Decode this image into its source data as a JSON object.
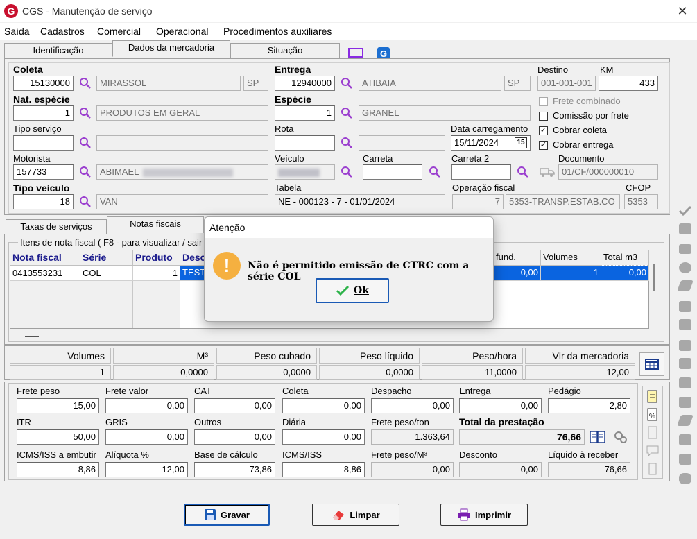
{
  "window": {
    "title": "CGS - Manutenção de serviço",
    "logo_letter": "G"
  },
  "menu": [
    "Saída",
    "Cadastros",
    "Comercial",
    "Operacional",
    "Procedimentos auxiliares"
  ],
  "tabs": [
    "Identificação",
    "Dados da mercadoria",
    "Situação"
  ],
  "form": {
    "coleta": {
      "label": "Coleta",
      "code": "15130000",
      "city": "MIRASSOL",
      "uf": "SP"
    },
    "entrega": {
      "label": "Entrega",
      "code": "12940000",
      "city": "ATIBAIA",
      "uf": "SP"
    },
    "destino": {
      "label": "Destino",
      "value": "001-001-001"
    },
    "km": {
      "label": "KM",
      "value": "433"
    },
    "nat_especie": {
      "label": "Nat. espécie",
      "code": "1",
      "desc": "PRODUTOS EM GERAL"
    },
    "especie": {
      "label": "Espécie",
      "code": "1",
      "desc": "GRANEL"
    },
    "tipo_servico": {
      "label": "Tipo serviço"
    },
    "rota": {
      "label": "Rota"
    },
    "data_carregamento": {
      "label": "Data carregamento",
      "value": "15/11/2024",
      "cal_icon": "15"
    },
    "motorista": {
      "label": "Motorista",
      "code": "157733",
      "name": "ABIMAEL"
    },
    "veiculo": {
      "label": "Veículo"
    },
    "carreta": {
      "label": "Carreta"
    },
    "carreta2": {
      "label": "Carreta 2"
    },
    "documento": {
      "label": "Documento",
      "value": "01/CF/000000010"
    },
    "tipo_veiculo": {
      "label": "Tipo veículo",
      "code": "18",
      "desc": "VAN"
    },
    "tabela": {
      "label": "Tabela",
      "value": "NE - 000123 - 7 - 01/01/2024"
    },
    "operacao_fiscal": {
      "label": "Operação fiscal",
      "code": "7",
      "desc": "5353-TRANSP.ESTAB.CO"
    },
    "cfop": {
      "label": "CFOP",
      "value": "5353"
    },
    "checks": {
      "frete_combinado": {
        "label": "Frete combinado",
        "checked": false
      },
      "comissao": {
        "label": "Comissão por frete",
        "checked": false
      },
      "cobrar_coleta": {
        "label": "Cobrar coleta",
        "checked": true
      },
      "cobrar_entrega": {
        "label": "Cobrar entrega",
        "checked": true
      }
    },
    "check_mark": "✓"
  },
  "subtabs": [
    "Taxas de serviços",
    "Notas fiscais"
  ],
  "itens": {
    "caption": "Itens de nota fiscal ( F8 - para visualizar / sair",
    "headers": [
      "Nota fiscal",
      "Série",
      "Produto",
      "Desc"
    ],
    "headers_right": [
      "fund.",
      "Volumes",
      "Total m3"
    ],
    "row": {
      "nota": "0413553231",
      "serie": "COL",
      "produto": "1",
      "desc": "TEST",
      "fund": "0,00",
      "volumes": "1",
      "total_m3": "0,00"
    }
  },
  "summary": {
    "headers": [
      "Volumes",
      "M³",
      "Peso cubado",
      "Peso líquido",
      "Peso/hora",
      "Vlr da mercadoria"
    ],
    "values": [
      "1",
      "0,0000",
      "0,0000",
      "0,0000",
      "11,0000",
      "12,00"
    ]
  },
  "values": {
    "row1": [
      {
        "label": "Frete peso",
        "value": "15,00"
      },
      {
        "label": "Frete valor",
        "value": "0,00"
      },
      {
        "label": "CAT",
        "value": "0,00"
      },
      {
        "label": "Coleta",
        "value": "0,00"
      },
      {
        "label": "Despacho",
        "value": "0,00"
      },
      {
        "label": "Entrega",
        "value": "0,00"
      },
      {
        "label": "Pedágio",
        "value": "2,80"
      }
    ],
    "row2": [
      {
        "label": "ITR",
        "value": "50,00"
      },
      {
        "label": "GRIS",
        "value": "0,00"
      },
      {
        "label": "Outros",
        "value": "0,00"
      },
      {
        "label": "Diária",
        "value": "0,00"
      },
      {
        "label": "Frete peso/ton",
        "value": "1.363,64"
      }
    ],
    "total": {
      "label": "Total da prestação",
      "value": "76,66"
    },
    "row3": [
      {
        "label": "ICMS/ISS a embutir",
        "value": "8,86"
      },
      {
        "label": "Alíquota %",
        "value": "12,00"
      },
      {
        "label": "Base de cálculo",
        "value": "73,86"
      },
      {
        "label": "ICMS/ISS",
        "value": "8,86"
      },
      {
        "label": "Frete peso/M³",
        "value": "0,00"
      },
      {
        "label": "Desconto",
        "value": "0,00"
      },
      {
        "label": "Líquido à receber",
        "value": "76,66"
      }
    ]
  },
  "buttons": {
    "gravar": "Gravar",
    "limpar": "Limpar",
    "imprimir": "Imprimir"
  },
  "dialog": {
    "title": "Atenção",
    "icon": "!",
    "message": "Não é permitido emissão de CTRC com a série COL",
    "ok": "Ok"
  },
  "colors": {
    "accent": "#1a5ab5",
    "selection": "#0a64e0",
    "warning": "#f5b040",
    "brand": "#c8102e",
    "magnifier": "#9b3fcf"
  }
}
